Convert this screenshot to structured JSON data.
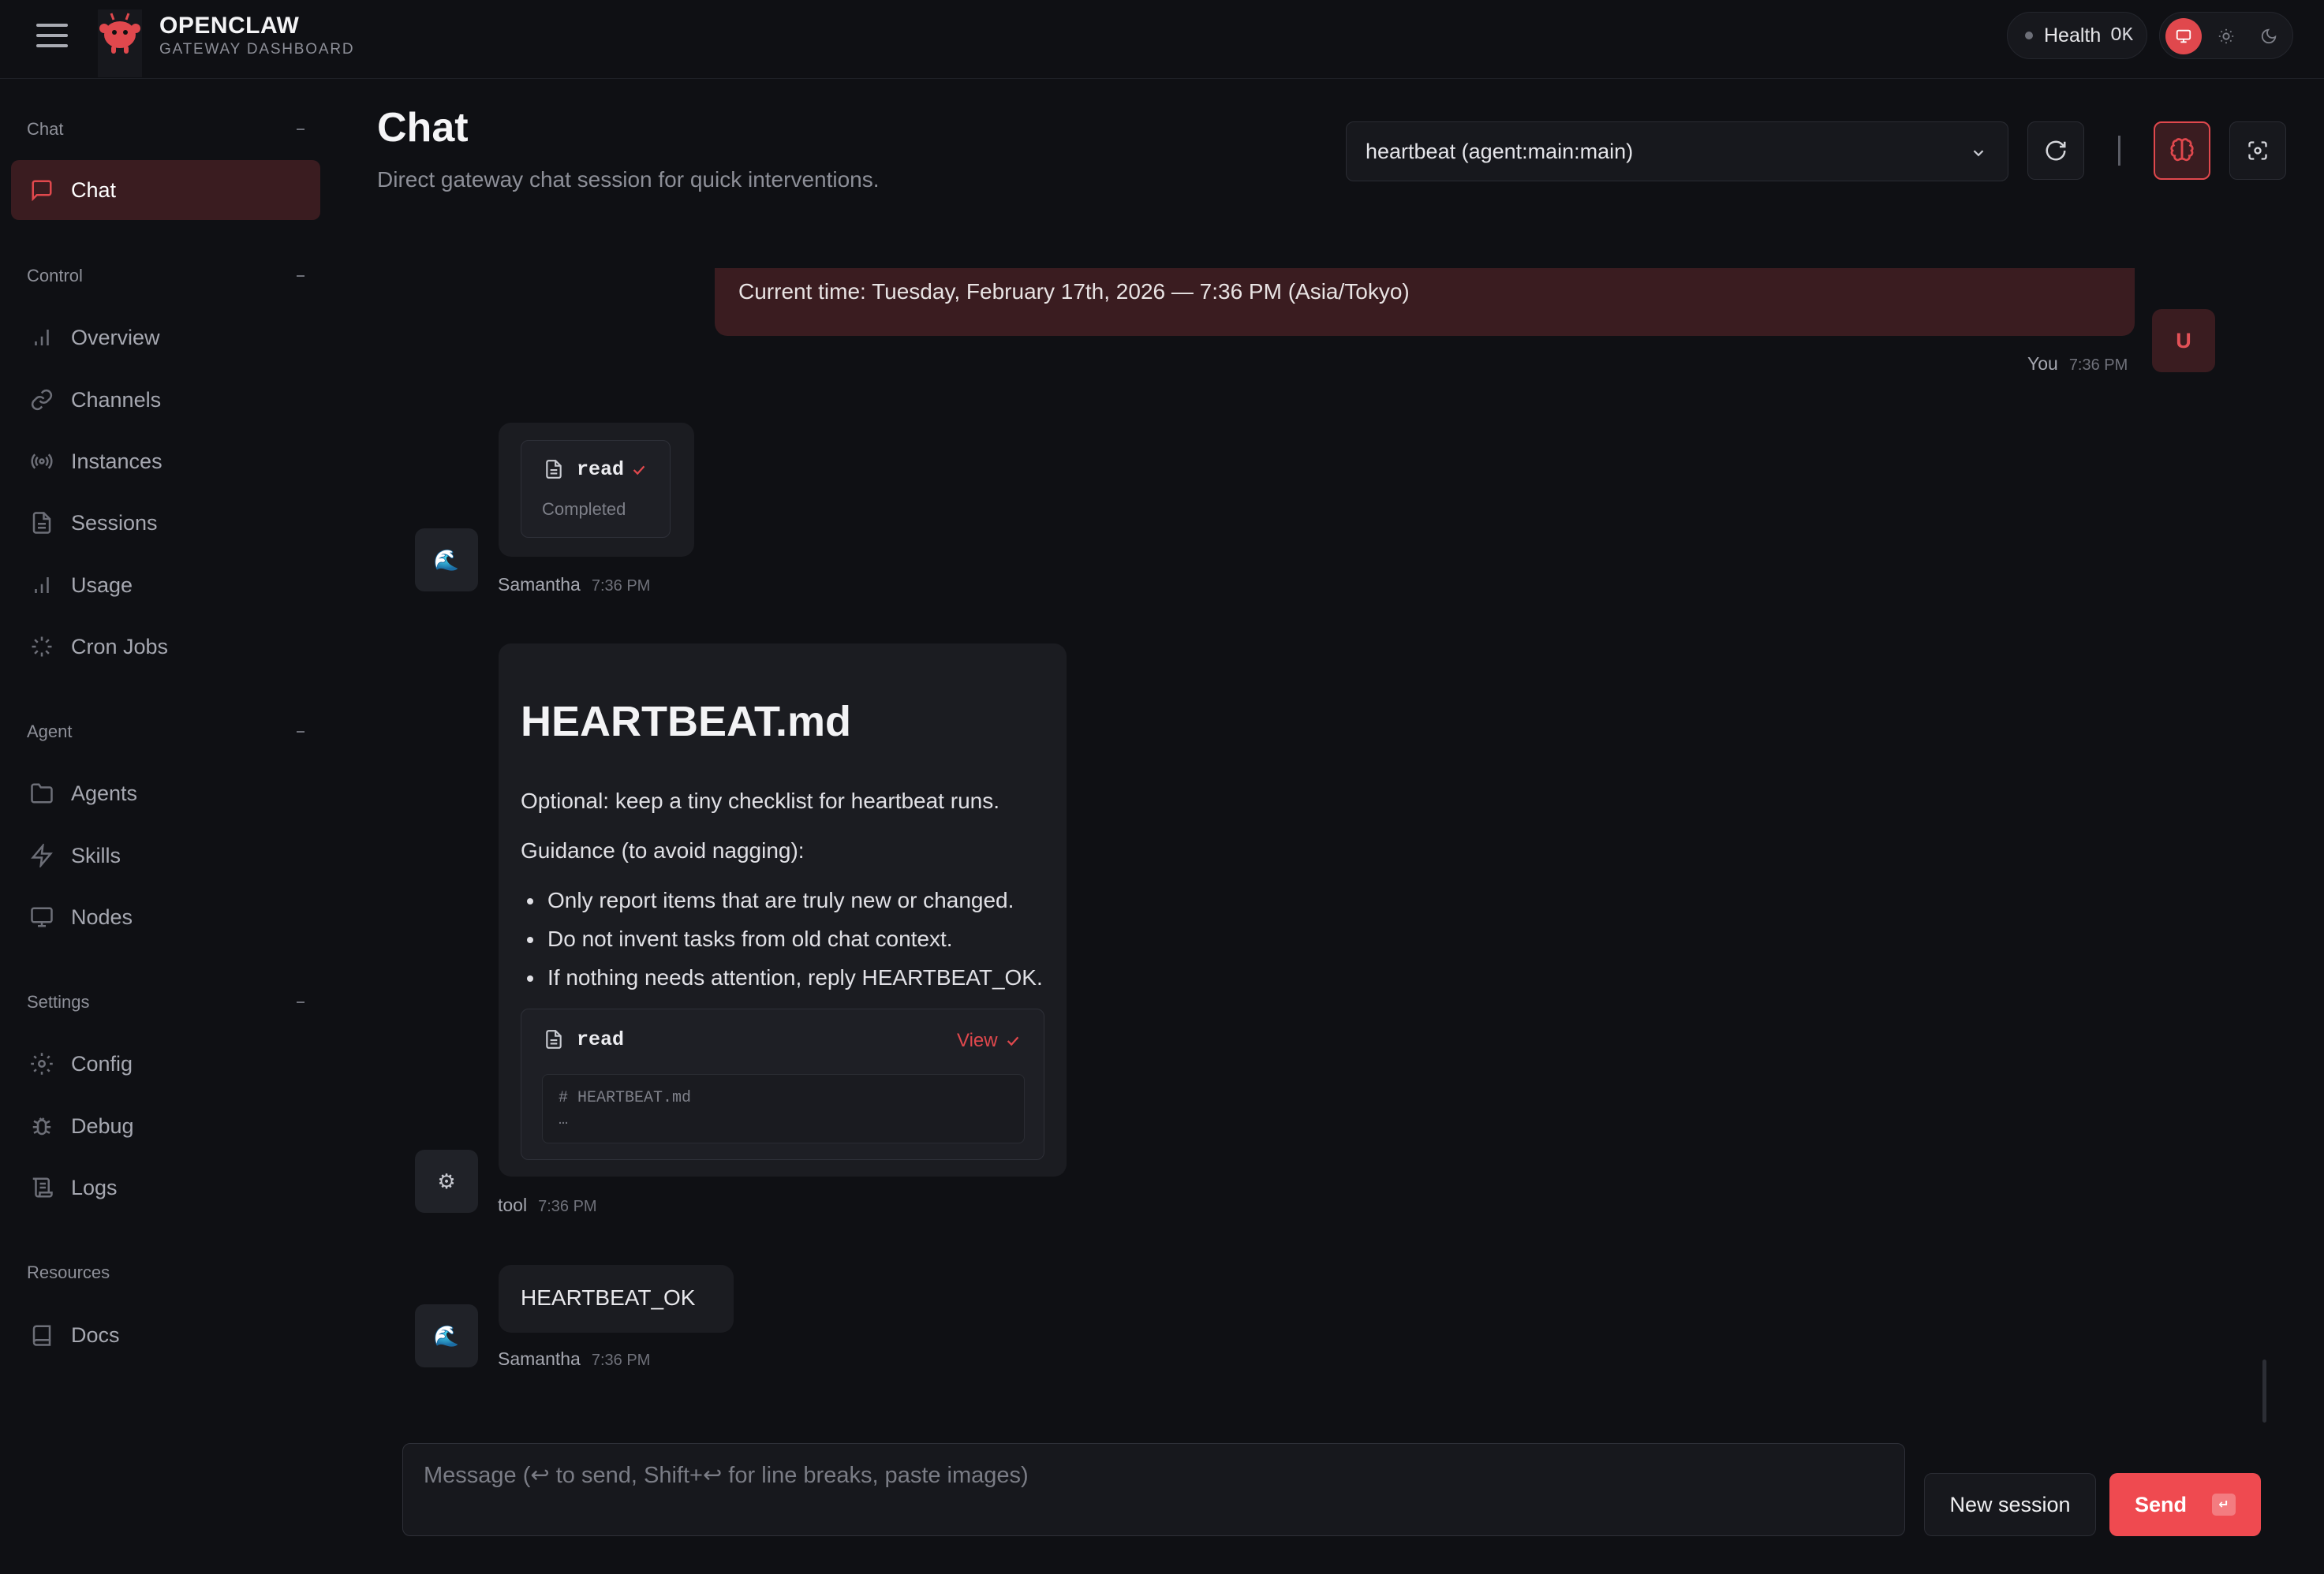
{
  "app": {
    "brand_title": "OPENCLAW",
    "brand_subtitle": "GATEWAY DASHBOARD",
    "health_label": "Health",
    "health_value": "OK",
    "accent_color": "#e0484d"
  },
  "sidebar": {
    "sections": [
      {
        "label": "Chat",
        "items": [
          {
            "label": "Chat",
            "icon": "message-icon",
            "active": true
          }
        ]
      },
      {
        "label": "Control",
        "items": [
          {
            "label": "Overview",
            "icon": "bar-chart-icon"
          },
          {
            "label": "Channels",
            "icon": "link-icon"
          },
          {
            "label": "Instances",
            "icon": "radio-icon"
          },
          {
            "label": "Sessions",
            "icon": "file-icon"
          },
          {
            "label": "Usage",
            "icon": "bar-chart-icon"
          },
          {
            "label": "Cron Jobs",
            "icon": "loader-icon"
          }
        ]
      },
      {
        "label": "Agent",
        "items": [
          {
            "label": "Agents",
            "icon": "folder-icon"
          },
          {
            "label": "Skills",
            "icon": "zap-icon"
          },
          {
            "label": "Nodes",
            "icon": "monitor-icon"
          }
        ]
      },
      {
        "label": "Settings",
        "items": [
          {
            "label": "Config",
            "icon": "gear-icon"
          },
          {
            "label": "Debug",
            "icon": "bug-icon"
          },
          {
            "label": "Logs",
            "icon": "scroll-icon"
          }
        ]
      },
      {
        "label": "Resources",
        "items": [
          {
            "label": "Docs",
            "icon": "book-icon"
          }
        ]
      }
    ]
  },
  "header": {
    "title": "Chat",
    "subtitle": "Direct gateway chat session for quick interventions.",
    "session_selected": "heartbeat (agent:main:main)"
  },
  "messages": {
    "user": {
      "text": "Current time: Tuesday, February 17th, 2026 — 7:36 PM (Asia/Tokyo)",
      "sender": "You",
      "time": "7:36 PM",
      "avatar": "U"
    },
    "tool_call": {
      "tool": "read",
      "status": "Completed",
      "sender": "Samantha",
      "time": "7:36 PM",
      "avatar": "🌊"
    },
    "tool_result": {
      "heading": "HEARTBEAT.md",
      "para1": "Optional: keep a tiny checklist for heartbeat runs.",
      "para2": "Guidance (to avoid nagging):",
      "bullets": [
        "Only report items that are truly new or changed.",
        "Do not invent tasks from old chat context.",
        "If nothing needs attention, reply HEARTBEAT_OK."
      ],
      "card_tool": "read",
      "card_action": "View",
      "code_line1": "# HEARTBEAT.md",
      "code_line2": "…",
      "sender": "tool",
      "time": "7:36 PM",
      "avatar": "⚙"
    },
    "reply": {
      "text": "HEARTBEAT_OK",
      "sender": "Samantha",
      "time": "7:36 PM",
      "avatar": "🌊"
    }
  },
  "composer": {
    "placeholder": "Message (↩ to send, Shift+↩ for line breaks, paste images)",
    "new_session_label": "New session",
    "send_label": "Send",
    "send_kbd": "↵"
  }
}
